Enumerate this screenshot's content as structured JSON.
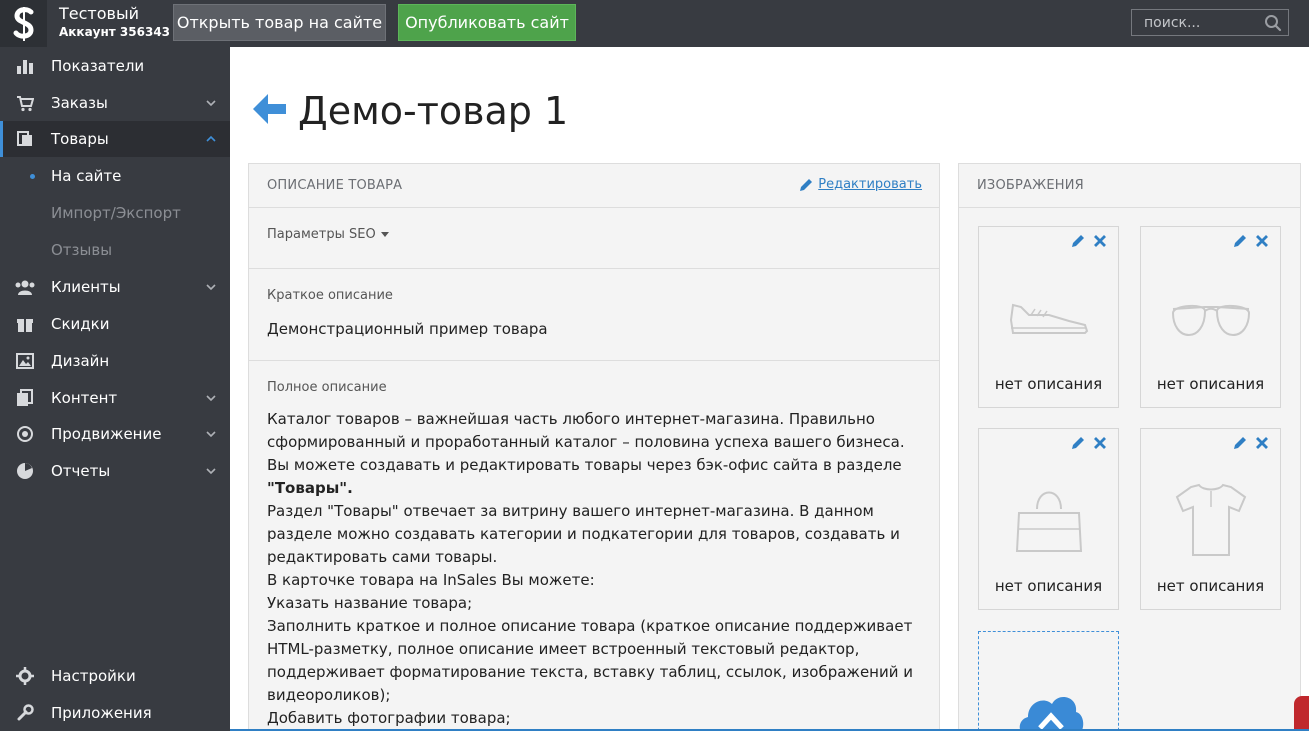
{
  "account": {
    "name": "Тестовый",
    "id_label": "Аккаунт 356343"
  },
  "toolbar": {
    "open_label": "Открыть товар на сайте",
    "publish_label": "Опубликовать сайт"
  },
  "search": {
    "placeholder": "поиск..."
  },
  "sidebar": {
    "items": [
      {
        "label": "Показатели",
        "icon": "bar-chart-icon"
      },
      {
        "label": "Заказы",
        "icon": "cart-icon"
      },
      {
        "label": "Товары",
        "icon": "products-icon"
      },
      {
        "label": "Клиенты",
        "icon": "users-icon"
      },
      {
        "label": "Скидки",
        "icon": "gift-icon"
      },
      {
        "label": "Дизайн",
        "icon": "image-icon"
      },
      {
        "label": "Контент",
        "icon": "content-icon"
      },
      {
        "label": "Продвижение",
        "icon": "target-icon"
      },
      {
        "label": "Отчеты",
        "icon": "pie-chart-icon"
      }
    ],
    "sub_items": [
      "На сайте",
      "Импорт/Экспорт",
      "Отзывы"
    ],
    "bottom_items": [
      {
        "label": "Настройки",
        "icon": "gear-icon"
      },
      {
        "label": "Приложения",
        "icon": "wrench-icon"
      }
    ]
  },
  "page": {
    "title": "Демо-товар 1"
  },
  "description": {
    "header": "ОПИСАНИЕ ТОВАРА",
    "edit_label": "Редактировать",
    "seo_label": "Параметры SEO",
    "short_label": "Краткое описание",
    "short_text": "Демонстрационный пример товара",
    "full_label": "Полное описание",
    "full_paragraphs": [
      "Каталог товаров – важнейшая часть любого интернет-магазина. Правильно сформированный и проработанный каталог – половина успеха вашего бизнеса.",
      "Вы можете создавать и редактировать товары через бэк-офис сайта в разделе",
      "\"Товары\".",
      "Раздел \"Товары\" отвечает за витрину вашего интернет-магазина. В данном разделе можно создавать категории и подкатегории для товаров, создавать и редактировать сами товары.",
      "В карточке товара на InSales Вы можете:",
      "Указать название товара;",
      "Заполнить краткое и полное описание товара (краткое описание поддерживает HTML-разметку, полное описание имеет встроенный текстовый редактор, поддерживает форматирование текста, вставку таблиц, ссылок, изображений и видеороликов);",
      "Добавить фотографии товара;"
    ]
  },
  "images": {
    "header": "ИЗОБРАЖЕНИЯ",
    "items": [
      {
        "caption": "нет описания",
        "icon": "shoe-icon"
      },
      {
        "caption": "нет описания",
        "icon": "sunglasses-icon"
      },
      {
        "caption": "нет описания",
        "icon": "bag-icon"
      },
      {
        "caption": "нет описания",
        "icon": "shirt-icon"
      }
    ]
  },
  "colors": {
    "accent": "#3f8fd8",
    "publish": "#4ea34b",
    "sidebar": "#383b41"
  }
}
